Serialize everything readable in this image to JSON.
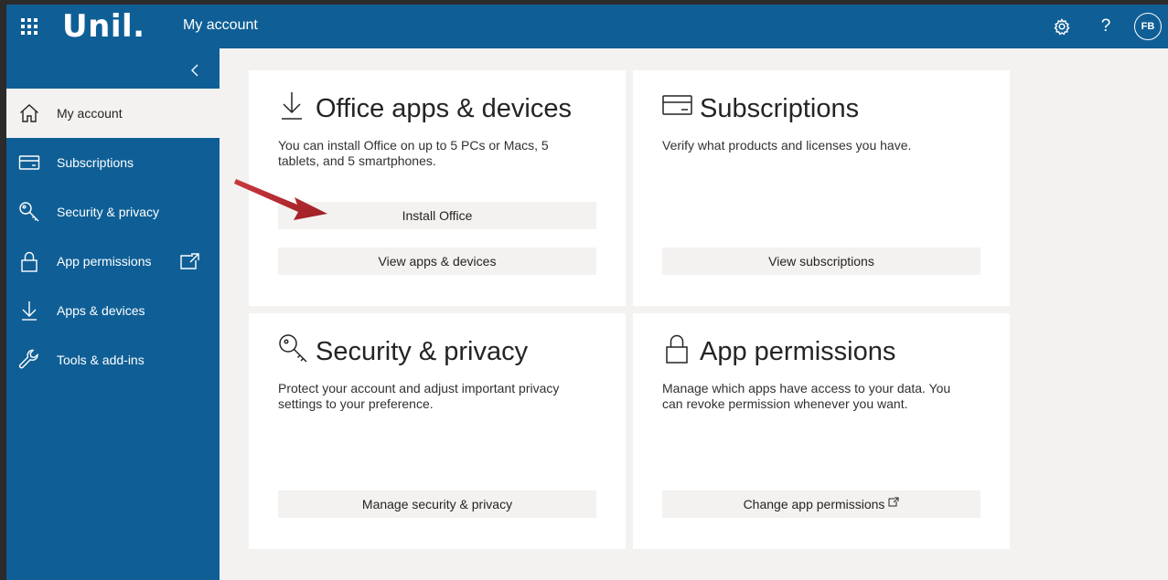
{
  "header": {
    "logo": "Unil.",
    "title": "My account",
    "avatar_initials": "FB"
  },
  "sidebar": {
    "items": [
      {
        "label": "My account",
        "icon": "home-icon",
        "active": true
      },
      {
        "label": "Subscriptions",
        "icon": "card-icon"
      },
      {
        "label": "Security & privacy",
        "icon": "key-icon"
      },
      {
        "label": "App permissions",
        "icon": "lock-icon"
      },
      {
        "label": "Apps & devices",
        "icon": "download-icon"
      },
      {
        "label": "Tools & add-ins",
        "icon": "wrench-icon"
      }
    ]
  },
  "cards": {
    "office": {
      "title": "Office apps & devices",
      "description": "You can install Office on up to 5 PCs or Macs, 5 tablets, and 5 smartphones.",
      "install_label": "Install Office",
      "view_label": "View apps & devices"
    },
    "subscriptions": {
      "title": "Subscriptions",
      "description": "Verify what products and licenses you have.",
      "view_label": "View subscriptions"
    },
    "security": {
      "title": "Security & privacy",
      "description": "Protect your account and adjust important privacy settings to your preference.",
      "manage_label": "Manage security & privacy"
    },
    "permissions": {
      "title": "App permissions",
      "description": "Manage which apps have access to your data. You can revoke permission whenever you want.",
      "change_label": "Change app permissions"
    }
  },
  "colors": {
    "brand_blue": "#0f5f96",
    "page_bg": "#f3f2f1",
    "annotation_arrow": "#b3262b"
  }
}
